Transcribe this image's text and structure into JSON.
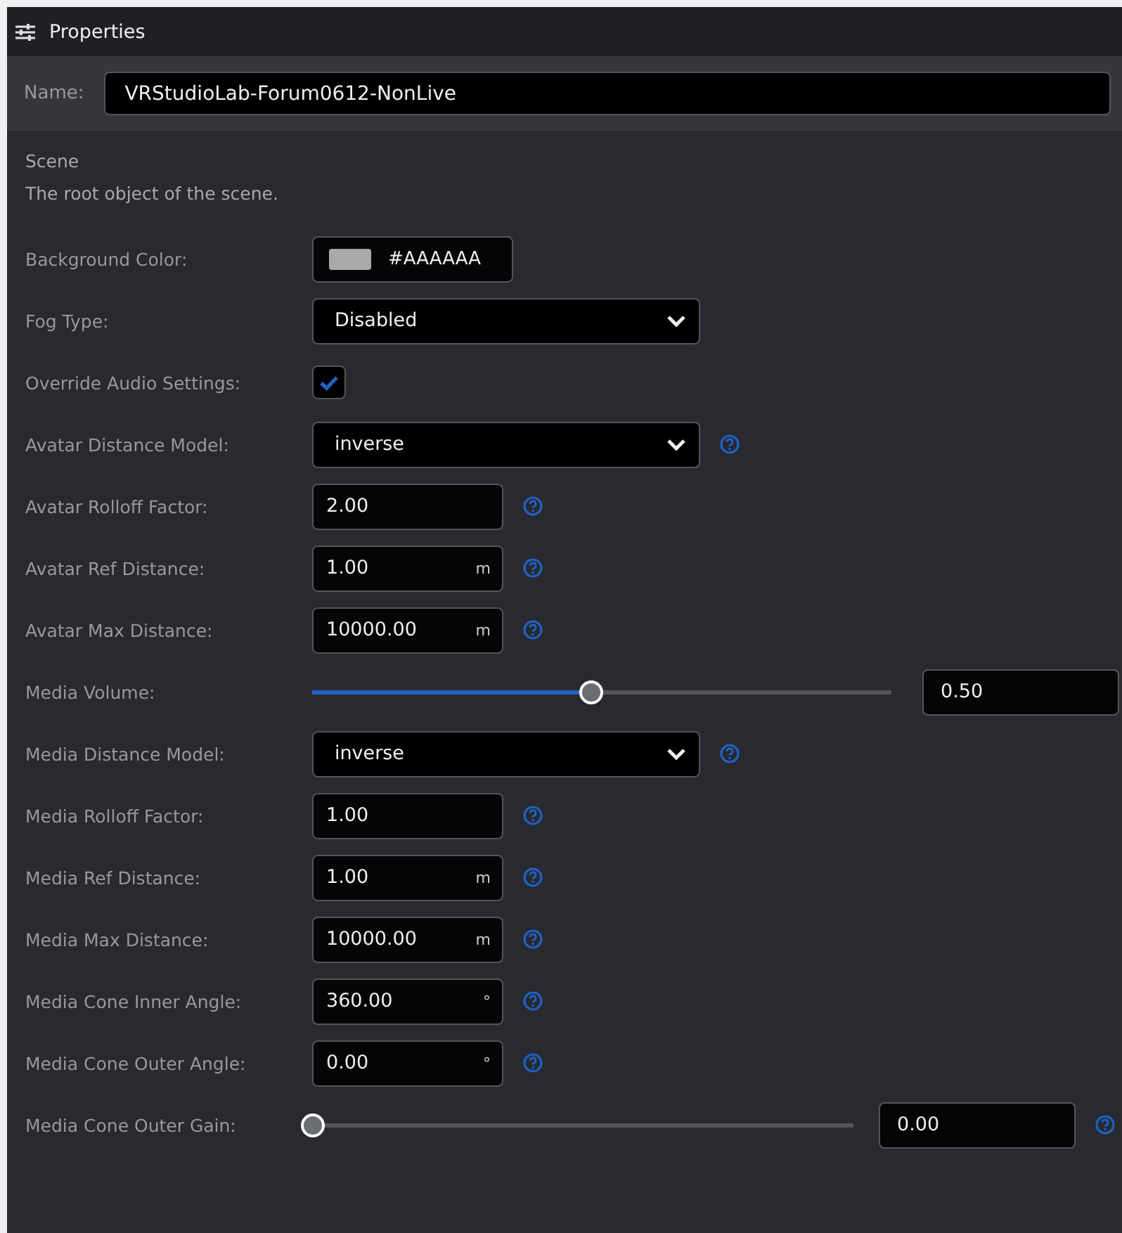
{
  "panel": {
    "title": "Properties"
  },
  "name_field": {
    "label": "Name:",
    "value": "VRStudioLab-Forum0612-NonLive"
  },
  "section": {
    "title": "Scene",
    "description": "The root object of the scene."
  },
  "rows": [
    {
      "kind": "color",
      "label": "Background Color:",
      "color": "#aaaaaa",
      "value": "#AAAAAA"
    },
    {
      "kind": "select",
      "label": "Fog Type:",
      "value": "Disabled",
      "help": false
    },
    {
      "kind": "checkbox",
      "label": "Override Audio Settings:",
      "checked": true
    },
    {
      "kind": "select",
      "label": "Avatar Distance Model:",
      "value": "inverse",
      "help": true
    },
    {
      "kind": "number",
      "label": "Avatar Rolloff Factor:",
      "value": "2.00",
      "help": true
    },
    {
      "kind": "number",
      "label": "Avatar Ref Distance:",
      "value": "1.00",
      "unit": "m",
      "help": true
    },
    {
      "kind": "number",
      "label": "Avatar Max Distance:",
      "value": "10000.00",
      "unit": "m",
      "help": true
    },
    {
      "kind": "slider",
      "label": "Media Volume:",
      "level": 0.48,
      "value": "0.50",
      "help": false
    },
    {
      "kind": "select",
      "label": "Media Distance Model:",
      "value": "inverse",
      "help": true
    },
    {
      "kind": "number",
      "label": "Media Rolloff Factor:",
      "value": "1.00",
      "help": true
    },
    {
      "kind": "number",
      "label": "Media Ref Distance:",
      "value": "1.00",
      "unit": "m",
      "help": true
    },
    {
      "kind": "number",
      "label": "Media Max Distance:",
      "value": "10000.00",
      "unit": "m",
      "help": true
    },
    {
      "kind": "number",
      "label": "Media Cone Inner Angle:",
      "value": "360.00",
      "unit": "°",
      "help": true
    },
    {
      "kind": "number",
      "label": "Media Cone Outer Angle:",
      "value": "0.00",
      "unit": "°",
      "help": true
    },
    {
      "kind": "slider",
      "label": "Media Cone Outer Gain:",
      "level": 0,
      "value": "0.00",
      "help": true
    }
  ]
}
